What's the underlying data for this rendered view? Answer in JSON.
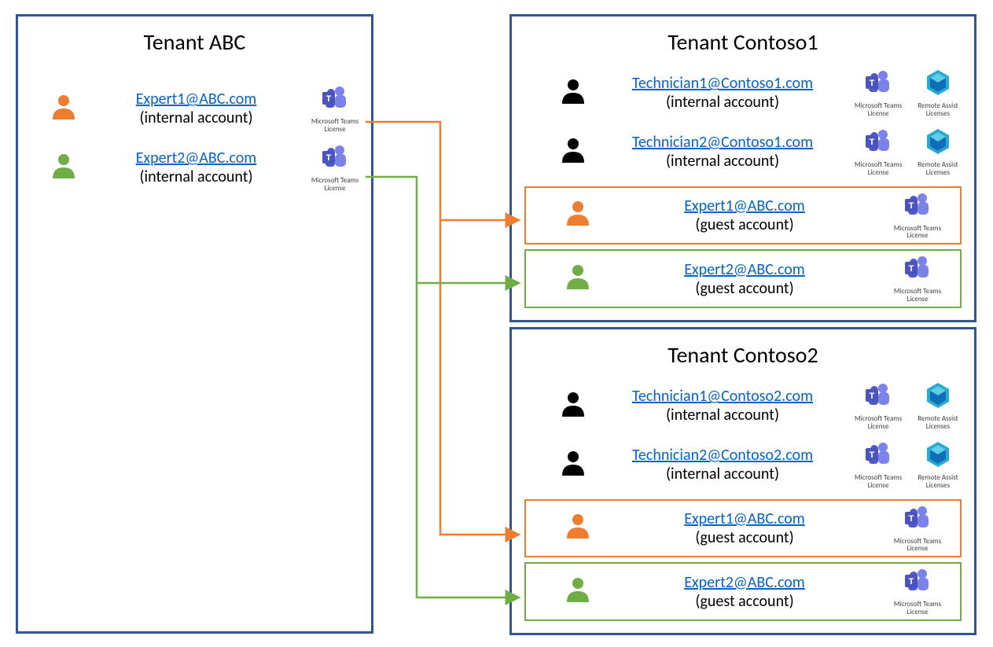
{
  "colors": {
    "orange": "#ed7d31",
    "green": "#70ad47",
    "black": "#000000",
    "link": "#0563c1",
    "border": "#2f5597"
  },
  "tenants": {
    "abc": {
      "title": "Tenant ABC",
      "users": [
        {
          "email": "Expert1@ABC.com",
          "type": "(internal account)",
          "color": "orange",
          "licenses": [
            {
              "name": "Microsoft Teams License"
            }
          ]
        },
        {
          "email": "Expert2@ABC.com",
          "type": "(internal account)",
          "color": "green",
          "licenses": [
            {
              "name": "Microsoft Teams License"
            }
          ]
        }
      ]
    },
    "contoso1": {
      "title": "Tenant Contoso1",
      "users": [
        {
          "email": "Technician1@Contoso1.com",
          "type": "(internal account)",
          "color": "black",
          "licenses": [
            {
              "name": "Microsoft Teams License"
            },
            {
              "name": "Remote Assist Licenses"
            }
          ]
        },
        {
          "email": "Technician2@Contoso1.com",
          "type": "(internal account)",
          "color": "black",
          "licenses": [
            {
              "name": "Microsoft Teams License"
            },
            {
              "name": "Remote Assist Licenses"
            }
          ]
        }
      ],
      "guests": [
        {
          "email": "Expert1@ABC.com",
          "type": "(guest account)",
          "color": "orange",
          "licenses": [
            {
              "name": "Microsoft Teams License"
            }
          ]
        },
        {
          "email": "Expert2@ABC.com",
          "type": "(guest account)",
          "color": "green",
          "licenses": [
            {
              "name": "Microsoft Teams License"
            }
          ]
        }
      ]
    },
    "contoso2": {
      "title": "Tenant Contoso2",
      "users": [
        {
          "email": "Technician1@Contoso2.com",
          "type": "(internal account)",
          "color": "black",
          "licenses": [
            {
              "name": "Microsoft Teams License"
            },
            {
              "name": "Remote Assist Licenses"
            }
          ]
        },
        {
          "email": "Technician2@Contoso2.com",
          "type": "(internal account)",
          "color": "black",
          "licenses": [
            {
              "name": "Microsoft Teams License"
            },
            {
              "name": "Remote Assist Licenses"
            }
          ]
        }
      ],
      "guests": [
        {
          "email": "Expert1@ABC.com",
          "type": "(guest account)",
          "color": "orange",
          "licenses": [
            {
              "name": "Microsoft Teams License"
            }
          ]
        },
        {
          "email": "Expert2@ABC.com",
          "type": "(guest account)",
          "color": "green",
          "licenses": [
            {
              "name": "Microsoft Teams License"
            }
          ]
        }
      ]
    }
  },
  "arrows": [
    {
      "from": "abc.expert1",
      "to": "contoso1.guest1",
      "color": "orange"
    },
    {
      "from": "abc.expert1",
      "to": "contoso2.guest1",
      "color": "orange"
    },
    {
      "from": "abc.expert2",
      "to": "contoso1.guest2",
      "color": "green"
    },
    {
      "from": "abc.expert2",
      "to": "contoso2.guest2",
      "color": "green"
    }
  ]
}
